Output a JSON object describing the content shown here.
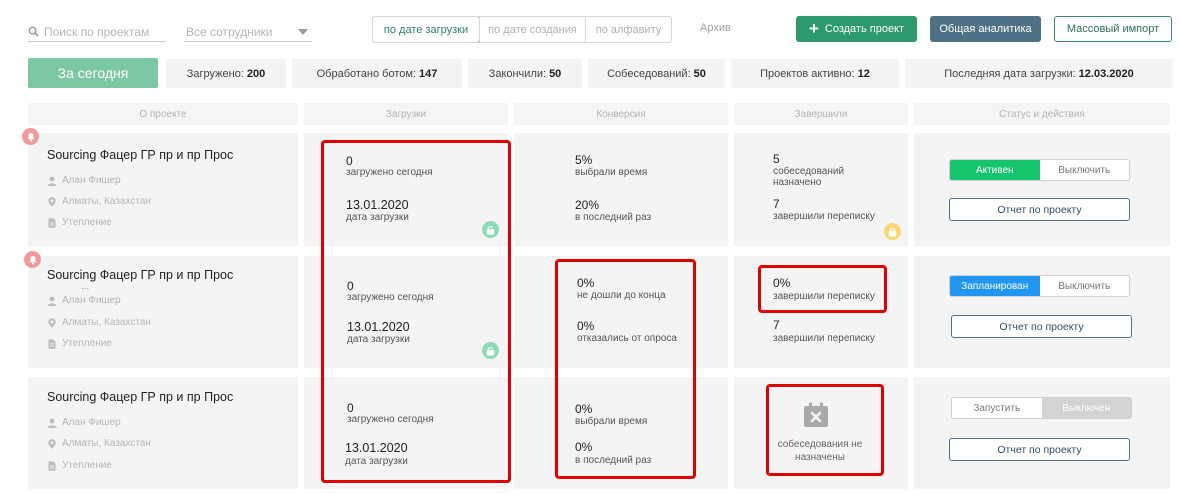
{
  "toolbar": {
    "search_placeholder": "Поиск по проектам",
    "employees_select": "Все сотрудники",
    "sort_options": [
      "по дате загрузки",
      "по дате создания",
      "по алфавиту"
    ],
    "active_sort": "по дате загрузки",
    "archive": "Архив",
    "create_button": "Создать проект",
    "analytics_button": "Общая аналитика",
    "import_button": "Массовый импорт"
  },
  "stats": {
    "today": "За сегодня",
    "items": [
      {
        "label": "Загружено:",
        "value": "200"
      },
      {
        "label": "Обработано ботом:",
        "value": "147"
      },
      {
        "label": "Закончили:",
        "value": "50"
      },
      {
        "label": "Собеседований:",
        "value": "50"
      },
      {
        "label": "Проектов активно:",
        "value": "12"
      },
      {
        "label": "Последняя дата загрузки:",
        "value": "12.03.2020"
      }
    ]
  },
  "columns": [
    "О проекте",
    "Загрузки",
    "Конверсия",
    "Завершили",
    "Статус и действия"
  ],
  "projects": [
    {
      "title": "Sourcing Фацер ГР пр и пр Прос",
      "has_dots": false,
      "owner": "Алан Фишер",
      "location": "Алматы, Казахстан",
      "category": "Утепление",
      "uploads": {
        "today_value": "0",
        "today_label": "загружено сегодня",
        "date_value": "13.01.2020",
        "date_label": "дата загрузки"
      },
      "conversion": {
        "v1": "5%",
        "l1": "выбрали время",
        "v2": "20%",
        "l2": "в последний раз"
      },
      "finished": {
        "v1": "5",
        "l1": "собеседований назначено",
        "v2": "7",
        "l2": "завершили переписку"
      },
      "status": {
        "left": "Активен",
        "right": "Выключить"
      },
      "report": "Отчет по проекту"
    },
    {
      "title": "Sourcing Фацер ГР пр и пр Прос",
      "dots": "...",
      "owner": "Алан Фишер",
      "location": "Алматы, Казахстан",
      "category": "Утепление",
      "uploads": {
        "today_value": "0",
        "today_label": "загружено сегодня",
        "date_value": "13.01.2020",
        "date_label": "дата загрузки"
      },
      "conversion": {
        "v1": "0%",
        "l1": "не дошли до конца",
        "v2": "0%",
        "l2": "отказались от опроса"
      },
      "finished": {
        "v1": "0%",
        "l1": "завершили переписку",
        "v2": "7",
        "l2": "завершили переписку"
      },
      "status": {
        "left": "Запланирован",
        "right": "Выключить"
      },
      "report": "Отчет по проекту"
    },
    {
      "title": "Sourcing Фацер ГР пр и пр Прос",
      "owner": "Алан Фишер",
      "location": "Алматы, Казахстан",
      "category": "Утепление",
      "uploads": {
        "today_value": "0",
        "today_label": "загружено сегодня",
        "date_value": "13.01.2020",
        "date_label": "дата загрузки"
      },
      "conversion": {
        "v1": "0%",
        "l1": "выбрали время",
        "v2": "0%",
        "l2": "в последний раз"
      },
      "finished": {
        "empty_line1": "собеседования не",
        "empty_line2": "назначены"
      },
      "status": {
        "left": "Запустить",
        "right": "Выключен"
      },
      "report": "Отчет по проекту"
    }
  ],
  "colors": {
    "primary_green": "#2d9a6e",
    "today_green": "#7cc8a2",
    "analytics": "#4f7186",
    "active_green": "#16c46e",
    "planned_blue": "#2196f3",
    "highlight_red": "#e00000",
    "bell_red": "#f19a9a"
  }
}
